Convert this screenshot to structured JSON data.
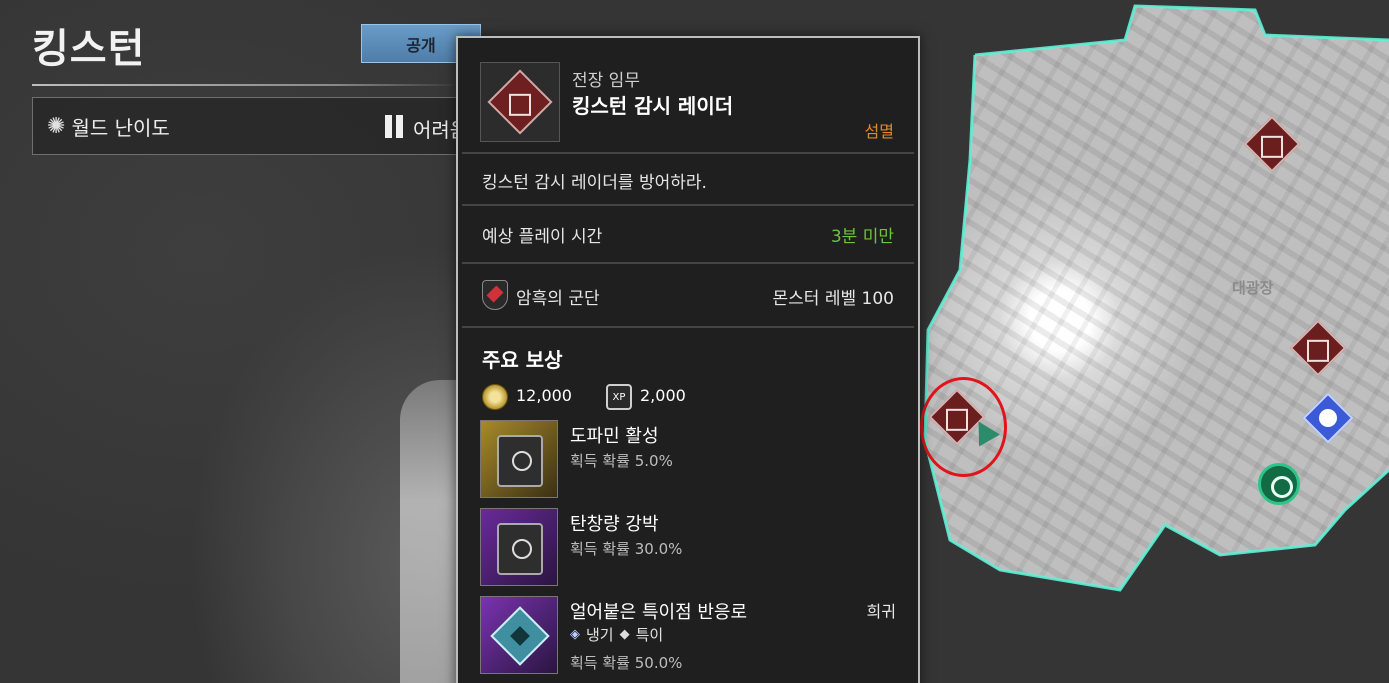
{
  "header": {
    "title": "킹스턴",
    "public_button": "공개"
  },
  "difficulty": {
    "label": "월드 난이도",
    "value": "어려움"
  },
  "map": {
    "area_label": "대광장"
  },
  "mission": {
    "type": "전장 임무",
    "name": "킹스턴 감시 레이더",
    "objective_tag": "섬멸",
    "description": "킹스턴 감시 레이더를 방어하라.",
    "playtime_label": "예상 플레이 시간",
    "playtime_value": "3분 미만",
    "faction": "암흑의 군단",
    "monster_level": "몬스터 레벨 100"
  },
  "rewards": {
    "title": "주요 보상",
    "gold": "12,000",
    "xp_badge": "XP",
    "xp": "2,000",
    "items": [
      {
        "name": "도파민 활성",
        "rate": "획득 확률 5.0%"
      },
      {
        "name": "탄창량 강박",
        "rate": "획득 확률 30.0%"
      },
      {
        "name": "얼어붙은 특이점 반응로",
        "tier": "희귀",
        "attr1": "냉기",
        "attr2": "특이",
        "rate": "획득 확률 50.0%"
      }
    ]
  },
  "colors": {
    "accent_orange": "#e08a2c",
    "playtime_green": "#6cc43a",
    "selection_red": "#e0141a",
    "map_border_cyan": "#5ff0d6"
  }
}
